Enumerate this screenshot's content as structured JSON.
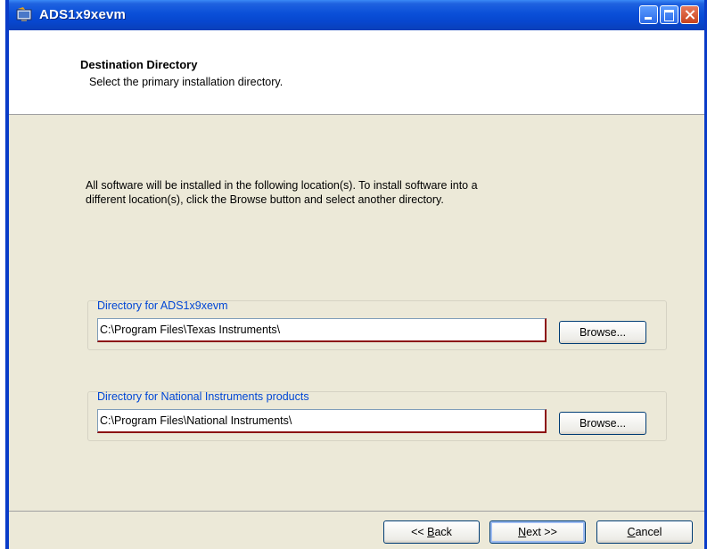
{
  "window": {
    "title": "ADS1x9xevm"
  },
  "header": {
    "title": "Destination Directory",
    "subtitle": "Select the primary installation directory."
  },
  "description": {
    "line1": "All software will be installed in the following location(s). To install software into a",
    "line2": "different location(s), click the Browse button and select another directory."
  },
  "groups": [
    {
      "label": "Directory for ADS1x9xevm",
      "path": "C:\\Program Files\\Texas Instruments\\",
      "browse_label": "Browse..."
    },
    {
      "label": "Directory for National Instruments products",
      "path": "C:\\Program Files\\National Instruments\\",
      "browse_label": "Browse..."
    }
  ],
  "footer": {
    "back_prefix": "<< ",
    "back_key": "B",
    "back_rest": "ack",
    "next_key": "N",
    "next_rest": "ext >>",
    "cancel_key": "C",
    "cancel_rest": "ancel"
  }
}
